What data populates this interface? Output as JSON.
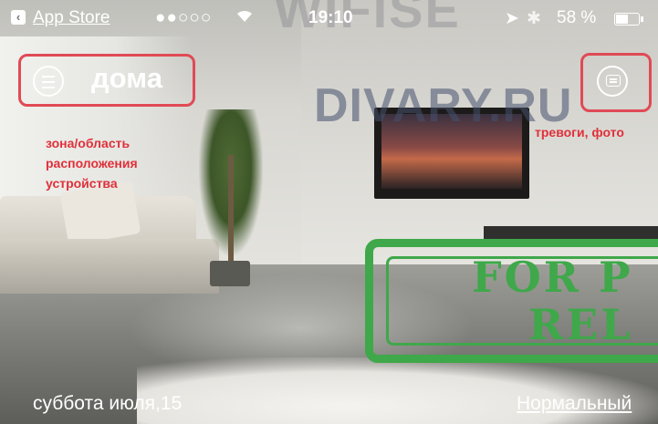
{
  "status_bar": {
    "back_label": "App Store",
    "signal": "●●○○○",
    "time": "19:10",
    "battery_text": "58 %",
    "battery_level": 0.58
  },
  "header": {
    "zone_title": "дома"
  },
  "annotations": {
    "zone_line1": "зона/область",
    "zone_line2": "расположения",
    "zone_line3": "устройства",
    "alarms": "тревоги, фото"
  },
  "watermarks": {
    "site": "DIVARY.RU",
    "top": "WIFISE",
    "stamp_line1": "FOR P",
    "stamp_line2": "REL"
  },
  "footer": {
    "date": "суббота июля,15",
    "mode": "Нормальный"
  },
  "colors": {
    "annotation_red": "#e0303a",
    "stamp_green": "#3fa84a"
  }
}
